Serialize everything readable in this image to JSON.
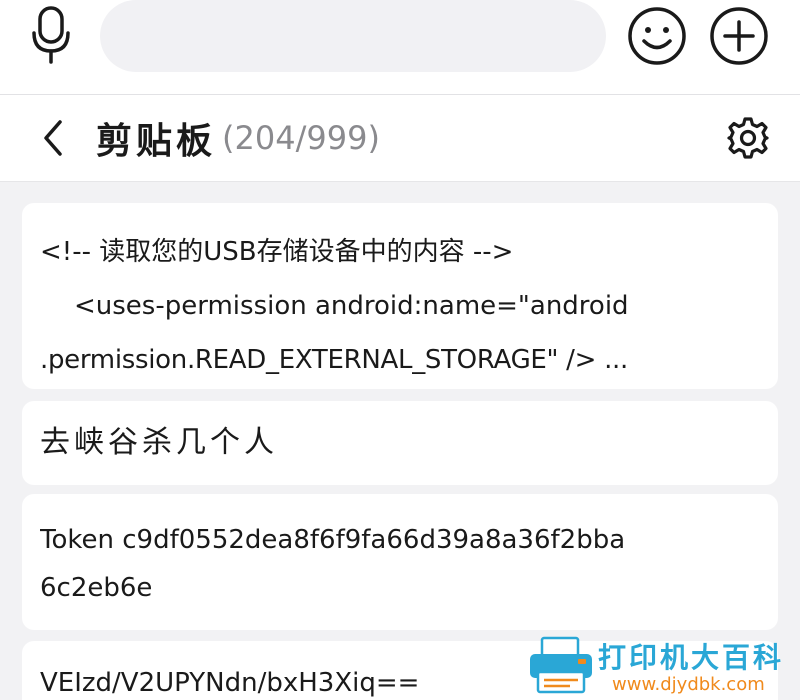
{
  "top_bar": {
    "voice_icon": "microphone-icon",
    "input_value": "",
    "emoji_icon": "smiley-icon",
    "plus_icon": "plus-circle-icon"
  },
  "header": {
    "back_icon": "chevron-left-icon",
    "title": "剪贴板",
    "count": "(204/999)",
    "settings_icon": "gear-icon"
  },
  "clips": [
    {
      "lines": [
        "<!-- 读取您的USB存储设备中的内容 -->",
        "<uses-permission android:name=\"android",
        ".permission.READ_EXTERNAL_STORAGE\" /> ..."
      ]
    },
    {
      "lines": [
        "去峡谷杀几个人"
      ]
    },
    {
      "lines": [
        "Token c9df0552dea8f6f9fa66d39a8a36f2bba",
        "6c2eb6e"
      ]
    },
    {
      "lines": [
        "VEIzd/V2UPYNdn/bxH3Xiq=="
      ]
    }
  ],
  "watermark": {
    "brand": "打印机大百科",
    "url": "www.djydbk.com",
    "icon": "printer-icon"
  },
  "colors": {
    "background": "#f2f2f4",
    "card": "#ffffff",
    "text": "#1a1a1a",
    "muted": "#8a8a8e",
    "watermark_blue": "#2aa7d6",
    "watermark_orange": "#f08a1c"
  }
}
